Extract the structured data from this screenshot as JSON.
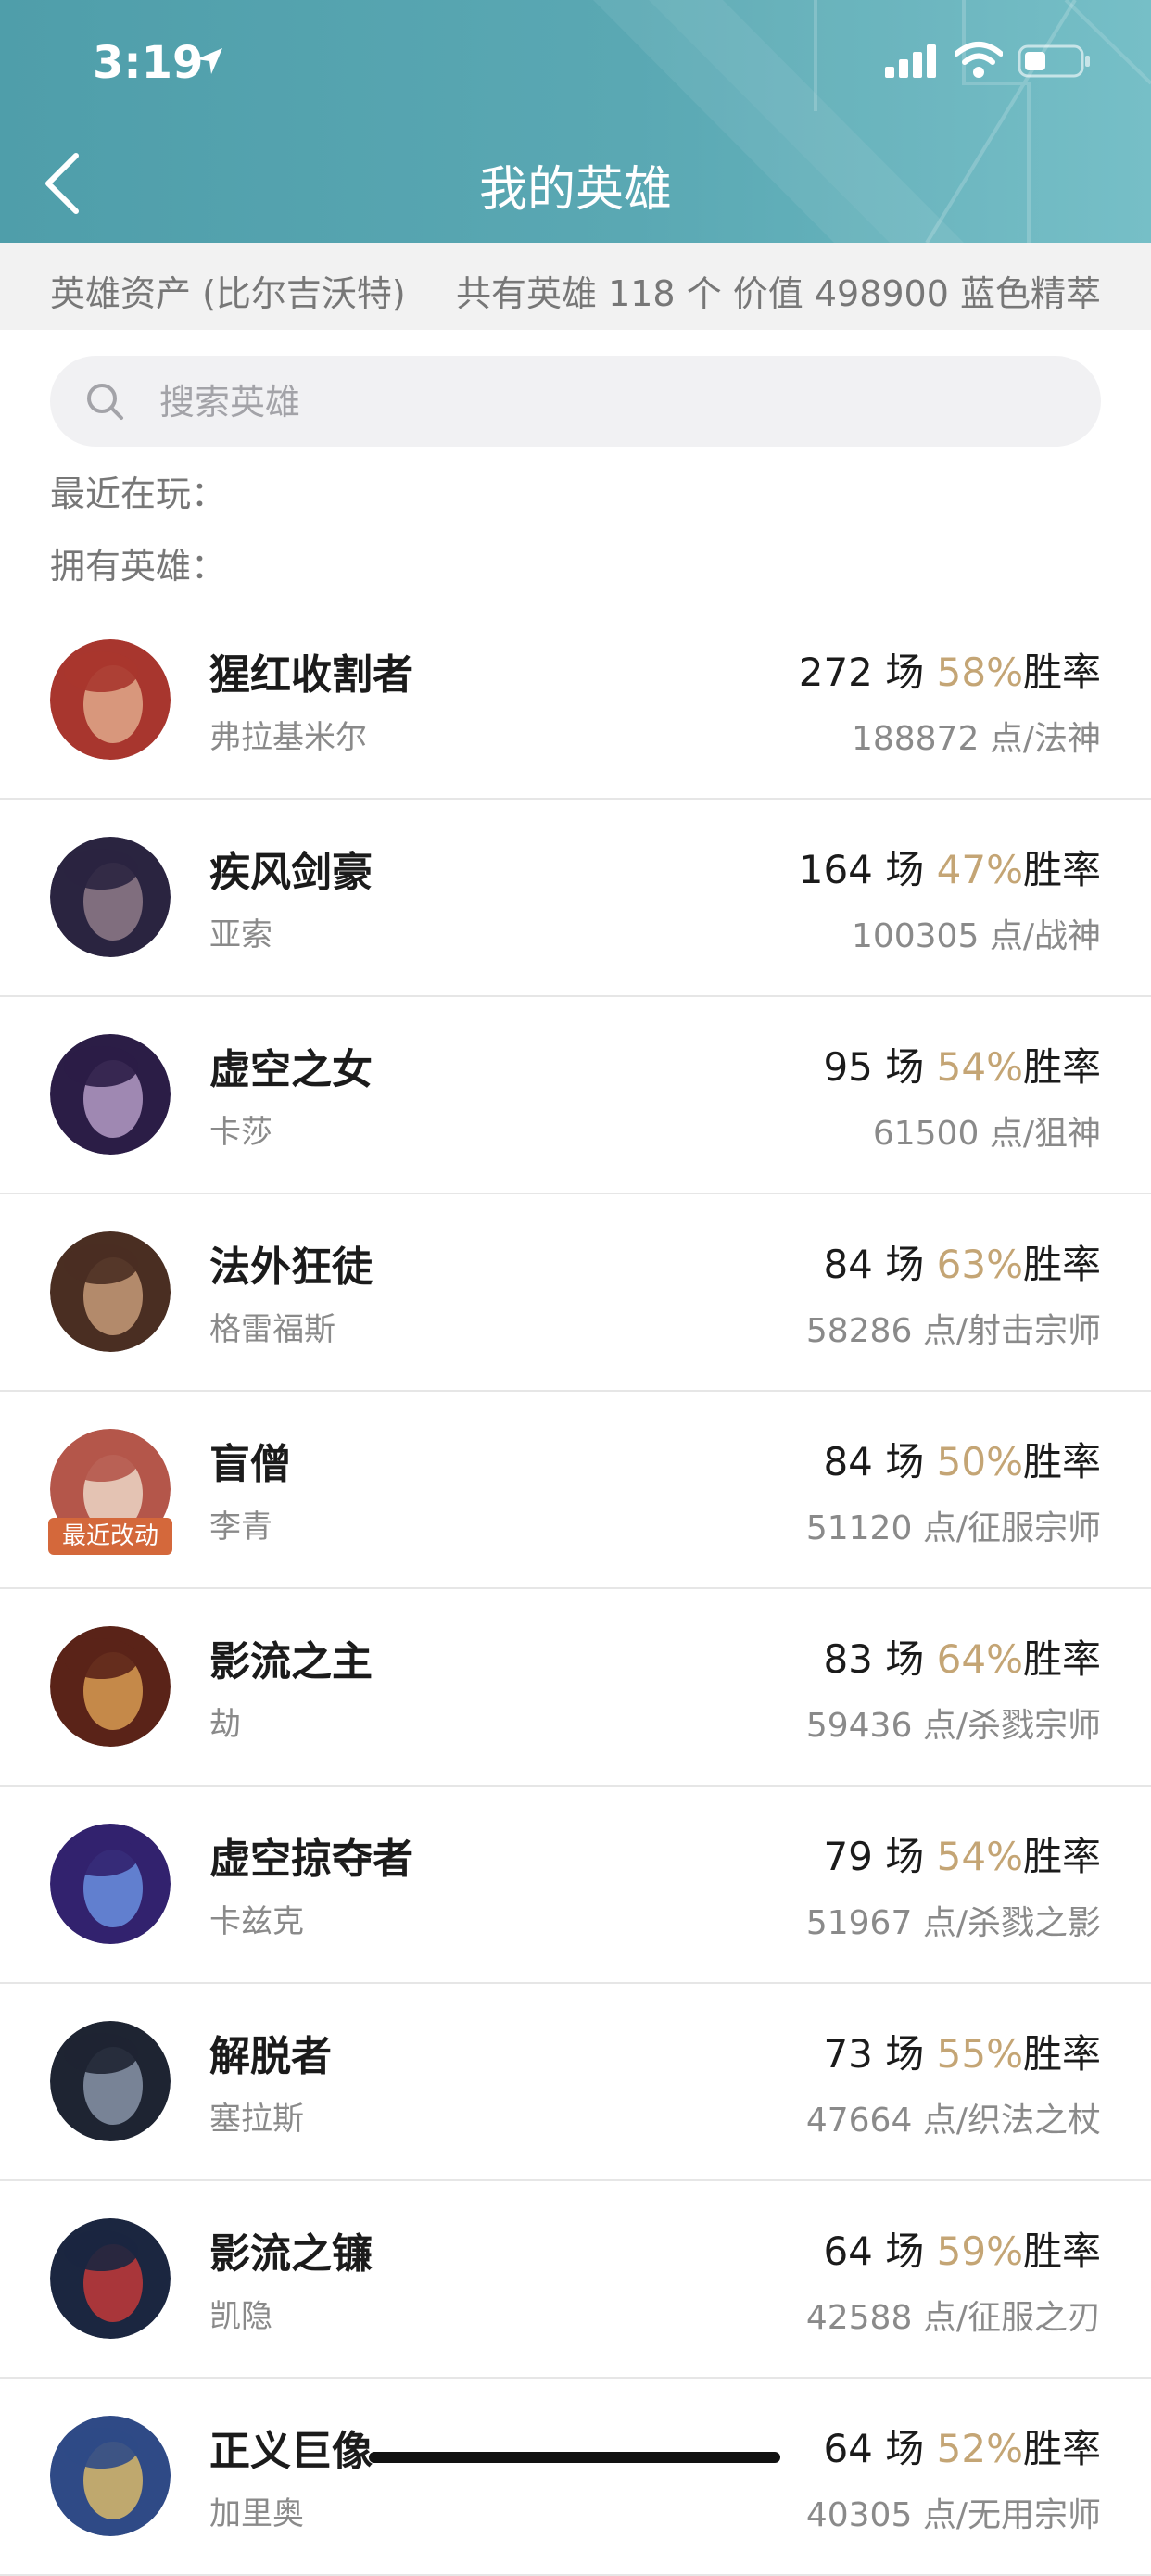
{
  "status_bar": {
    "time": "3:19"
  },
  "header": {
    "title": "我的英雄"
  },
  "assets": {
    "label": "英雄资产 (比尔吉沃特)",
    "summary": "共有英雄 118 个 价值 498900 蓝色精萃"
  },
  "search": {
    "placeholder": "搜索英雄",
    "value": ""
  },
  "sections": {
    "recent": "最近在玩：",
    "owned": "拥有英雄："
  },
  "labels": {
    "games_suffix": "场",
    "winrate_suffix": "胜率",
    "points_suffix": "点"
  },
  "colors": {
    "header": "#5aa8b3",
    "winrate": "#c4a575",
    "badge": "#d4683b"
  },
  "heroes": [
    {
      "name": "猩红收割者",
      "alias": "弗拉基米尔",
      "games": "272",
      "winrate": "58%",
      "points": "188872",
      "title": "法神",
      "avatar_color": "#a8362e",
      "avatar_light": "#e0a889"
    },
    {
      "name": "疾风剑豪",
      "alias": "亚索",
      "games": "164",
      "winrate": "47%",
      "points": "100305",
      "title": "战神",
      "avatar_color": "#2a2440",
      "avatar_light": "#8f7b8a"
    },
    {
      "name": "虚空之女",
      "alias": "卡莎",
      "games": "95",
      "winrate": "54%",
      "points": "61500",
      "title": "狙神",
      "avatar_color": "#2b1d46",
      "avatar_light": "#b49bc6"
    },
    {
      "name": "法外狂徒",
      "alias": "格雷福斯",
      "games": "84",
      "winrate": "63%",
      "points": "58286",
      "title": "射击宗师",
      "avatar_color": "#4a2e22",
      "avatar_light": "#c69a78"
    },
    {
      "name": "盲僧",
      "alias": "李青",
      "games": "84",
      "winrate": "50%",
      "points": "51120",
      "title": "征服宗师",
      "avatar_color": "#b4564a",
      "avatar_light": "#ecd6c6",
      "badge": "最近改动"
    },
    {
      "name": "影流之主",
      "alias": "劫",
      "games": "83",
      "winrate": "64%",
      "points": "59436",
      "title": "杀戮宗师",
      "avatar_color": "#5a2318",
      "avatar_light": "#d89b52"
    },
    {
      "name": "虚空掠夺者",
      "alias": "卡兹克",
      "games": "79",
      "winrate": "54%",
      "points": "51967",
      "title": "杀戮之影",
      "avatar_color": "#32226e",
      "avatar_light": "#6a8fe0"
    },
    {
      "name": "解脱者",
      "alias": "塞拉斯",
      "games": "73",
      "winrate": "55%",
      "points": "47664",
      "title": "织法之杖",
      "avatar_color": "#1e2432",
      "avatar_light": "#8894a8"
    },
    {
      "name": "影流之镰",
      "alias": "凯隐",
      "games": "64",
      "winrate": "59%",
      "points": "42588",
      "title": "征服之刃",
      "avatar_color": "#1b2640",
      "avatar_light": "#c23a3a"
    },
    {
      "name": "正义巨像",
      "alias": "加里奥",
      "games": "64",
      "winrate": "52%",
      "points": "40305",
      "title": "无用宗师",
      "avatar_color": "#2f4a86",
      "avatar_light": "#d8b86a"
    }
  ]
}
